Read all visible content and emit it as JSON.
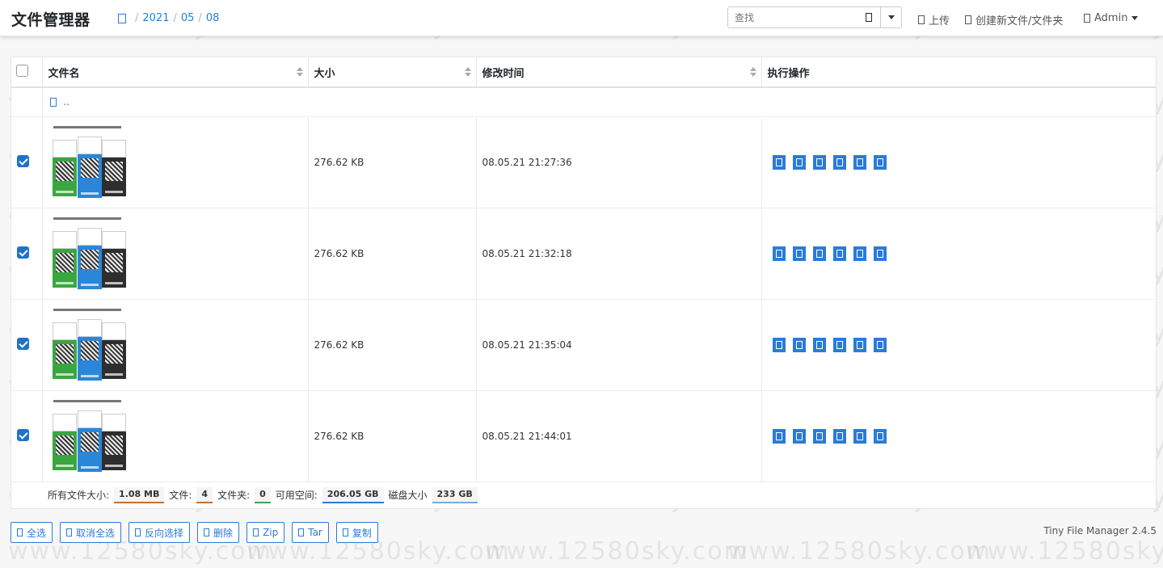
{
  "navbar": {
    "brand": "文件管理器",
    "breadcrumb": [
      "2021",
      "05",
      "08"
    ],
    "search_placeholder": "查找",
    "upload_label": "上传",
    "create_label": "创建新文件/文件夹",
    "user_label": "Admin"
  },
  "table": {
    "headers": [
      "文件名",
      "大小",
      "修改时间",
      "执行操作"
    ],
    "parent_link": "..",
    "rows": [
      {
        "size": "276.62 KB",
        "modified": "08.05.21 21:27:36",
        "checked": true
      },
      {
        "size": "276.62 KB",
        "modified": "08.05.21 21:32:18",
        "checked": true
      },
      {
        "size": "276.62 KB",
        "modified": "08.05.21 21:35:04",
        "checked": true
      },
      {
        "size": "276.62 KB",
        "modified": "08.05.21 21:44:01",
        "checked": true
      }
    ]
  },
  "stats": {
    "total_label": "所有文件大小:",
    "total_value": "1.08 MB",
    "files_label": "文件:",
    "files_value": "4",
    "folders_label": "文件夹:",
    "folders_value": "0",
    "free_label": "可用空间:",
    "free_value": "206.05 GB",
    "disk_label": "磁盘大小",
    "disk_value": "233 GB",
    "colors": {
      "total": "#c8702a",
      "files": "#c8702a",
      "folders": "#3aa655",
      "free": "#2a7bd8",
      "disk": "#7aa8e0"
    }
  },
  "buttons": {
    "select_all": "全选",
    "deselect_all": "取消全选",
    "invert": "反向选择",
    "delete": "删除",
    "zip": "Zip",
    "tar": "Tar",
    "copy": "复制"
  },
  "version": "Tiny File Manager 2.4.5",
  "watermark": "www.12580sky.com",
  "colors": {
    "accent": "#2a7bd8",
    "checkbox": "#1d73c9"
  }
}
